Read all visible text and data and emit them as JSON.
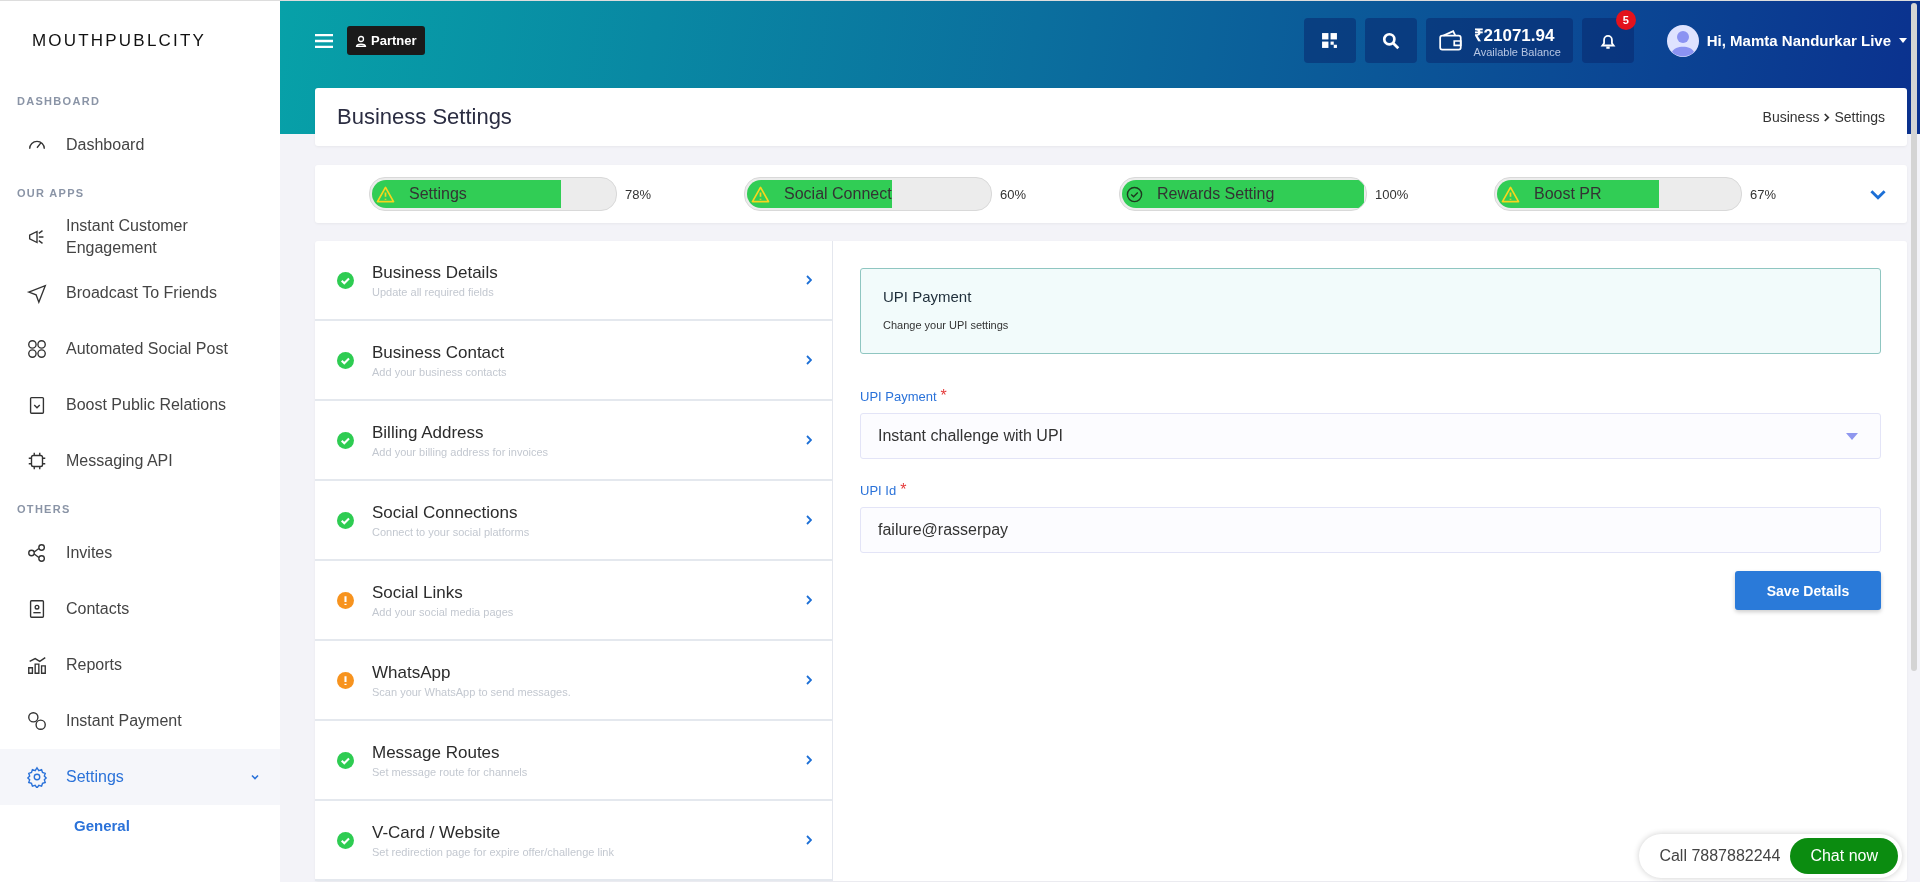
{
  "brand": "MOUTHPUBLCITY",
  "sidebar": {
    "sections": [
      {
        "heading": "DASHBOARD",
        "items": [
          {
            "label": "Dashboard",
            "selected": false
          }
        ]
      },
      {
        "heading": "OUR APPS",
        "items": [
          {
            "label": "Instant Customer Engagement",
            "selected": false
          },
          {
            "label": "Broadcast To Friends",
            "selected": false
          },
          {
            "label": "Automated Social Post",
            "selected": false
          },
          {
            "label": "Boost Public Relations",
            "selected": false
          },
          {
            "label": "Messaging API",
            "selected": false
          }
        ]
      },
      {
        "heading": "OTHERS",
        "items": [
          {
            "label": "Invites",
            "selected": false
          },
          {
            "label": "Contacts",
            "selected": false
          },
          {
            "label": "Reports",
            "selected": false
          },
          {
            "label": "Instant Payment",
            "selected": false
          },
          {
            "label": "Settings",
            "selected": true,
            "expanded": true,
            "children": [
              {
                "label": "General",
                "selected": true
              }
            ]
          }
        ]
      }
    ]
  },
  "header": {
    "badge": "Partner",
    "balance": "₹21071.94",
    "balance_label": "Available Balance",
    "notifications": "5",
    "greeting": "Hi, Mamta Nandurkar Live"
  },
  "page": {
    "title": "Business Settings",
    "breadcrumb": [
      "Business",
      "Settings"
    ]
  },
  "progress": [
    {
      "label": "Settings",
      "level": 0.78,
      "reading": "78%",
      "complete": false
    },
    {
      "label": "Social Connect",
      "level": 0.6,
      "reading": "60%",
      "complete": false
    },
    {
      "label": "Rewards Setting",
      "level": 1,
      "reading": "100%",
      "complete": true
    },
    {
      "label": "Boost PR",
      "level": 0.67,
      "reading": "67%",
      "complete": false
    }
  ],
  "steps": [
    {
      "title": "Business Details",
      "subtitle": "Update all required fields",
      "complete": true
    },
    {
      "title": "Business Contact",
      "subtitle": "Add your business contacts",
      "complete": true
    },
    {
      "title": "Billing Address",
      "subtitle": "Add your billing address for invoices",
      "complete": true
    },
    {
      "title": "Social Connections",
      "subtitle": "Connect to your social platforms",
      "complete": true
    },
    {
      "title": "Social Links",
      "subtitle": "Add your social media pages",
      "complete": false
    },
    {
      "title": "WhatsApp",
      "subtitle": "Scan your WhatsApp to send messages.",
      "complete": false
    },
    {
      "title": "Message Routes",
      "subtitle": "Set message route for channels",
      "complete": true
    },
    {
      "title": "V-Card / Website",
      "subtitle": "Set redirection page for expire offer/challenge link",
      "complete": true
    }
  ],
  "panel": {
    "title": "UPI Payment",
    "subtitle": "Change your UPI settings",
    "fields": [
      {
        "kind": "select",
        "label": "UPI Payment",
        "required_mark": "*",
        "value": "Instant challenge with UPI"
      },
      {
        "kind": "text",
        "label": "UPI Id",
        "required_mark": "*",
        "value": "failure@rasserpay"
      }
    ],
    "button": "Save Details"
  },
  "chat": {
    "call": "Call 7887882244",
    "button": "Chat now"
  }
}
